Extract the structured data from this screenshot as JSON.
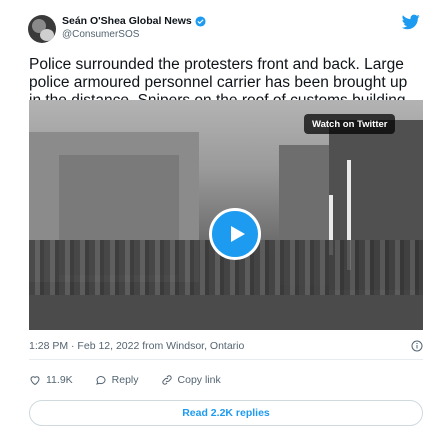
{
  "author": {
    "name": "Seán O'Shea Global News",
    "handle": "@ConsumerSOS"
  },
  "tweet": {
    "text": "Police surrounded the protesters front and back. Large police armoured personnel carrier has been brought up in the distance. Snipers on the roof of customs building."
  },
  "media": {
    "watch_label": "Watch on Twitter"
  },
  "meta": {
    "timestamp": "1:28 PM · Feb 12, 2022 from Windsor, Ontario"
  },
  "actions": {
    "likes": "11.9K",
    "reply_label": "Reply",
    "copy_link_label": "Copy link"
  },
  "replies": {
    "label": "Read 2.2K replies"
  },
  "colors": {
    "twitter_blue": "#1d9bf0",
    "muted_text": "#536471"
  }
}
